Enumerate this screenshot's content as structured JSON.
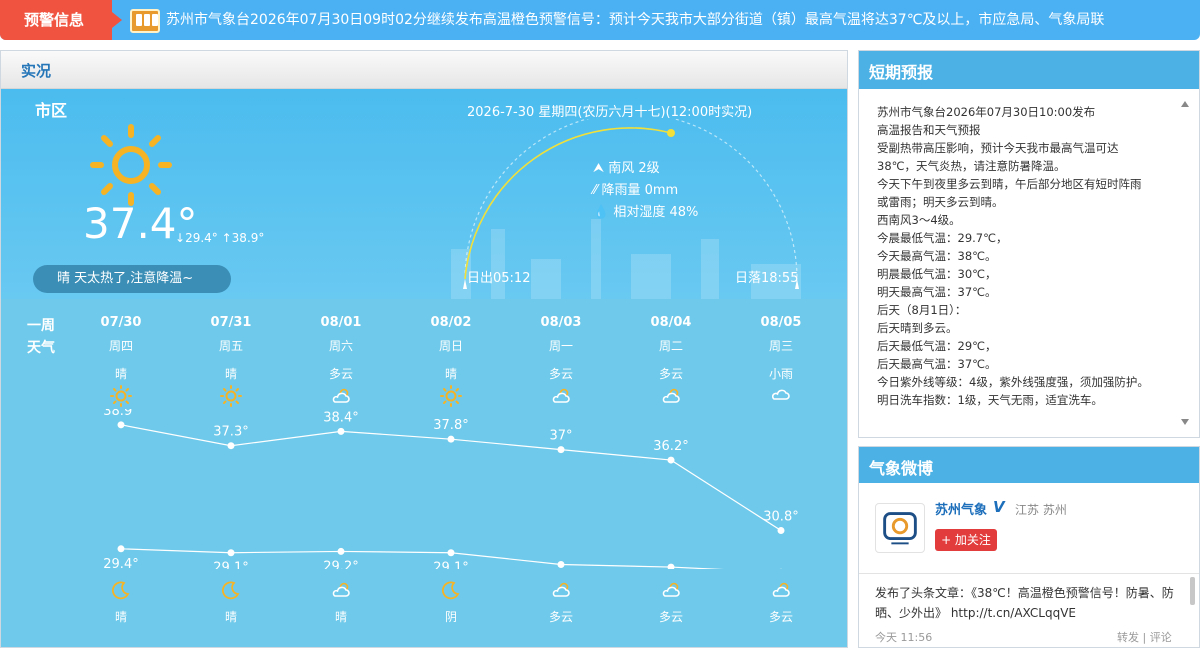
{
  "alert": {
    "tag": "预警信息",
    "text": "苏州市气象台2026年07月30日09时02分继续发布高温橙色预警信号：预计今天我市大部分街道（镇）最高气温将达37℃及以上，市应急局、气象局联"
  },
  "now": {
    "panel_title": "实况",
    "city": "市区",
    "temperature": "37.4°",
    "low": "29.4°",
    "high": "38.9°",
    "description": "晴  天太热了,注意降温~",
    "date_line": "2026-7-30  星期四(农历六月十七)(12:00时实况)",
    "wind": "南风  2级",
    "rain": "降雨量  0mm",
    "humidity": "相对湿度  48%",
    "sunrise": "日出05:12",
    "sunset": "日落18:55"
  },
  "week": {
    "label_line1": "一周",
    "label_line2": "天气",
    "days": [
      {
        "date": "07/30",
        "weekday": "周四",
        "day_cond": "晴",
        "day_icon": "sunny-icon",
        "high": "38.9°",
        "low": "29.4°",
        "night_icon": "moon-icon",
        "night_cond": "晴"
      },
      {
        "date": "07/31",
        "weekday": "周五",
        "day_cond": "晴",
        "day_icon": "sunny-icon",
        "high": "37.3°",
        "low": "29.1°",
        "night_icon": "moon-icon",
        "night_cond": "晴"
      },
      {
        "date": "08/01",
        "weekday": "周六",
        "day_cond": "多云",
        "day_icon": "cloudy-icon",
        "high": "38.4°",
        "low": "29.2°",
        "night_icon": "cloudy-icon",
        "night_cond": "晴"
      },
      {
        "date": "08/02",
        "weekday": "周日",
        "day_cond": "晴",
        "day_icon": "sunny-icon",
        "high": "37.8°",
        "low": "29.1°",
        "night_icon": "moon-icon",
        "night_cond": "阴"
      },
      {
        "date": "08/03",
        "weekday": "周一",
        "day_cond": "多云",
        "day_icon": "cloudy-icon",
        "high": "37°",
        "low": "28.2°",
        "night_icon": "cloudy-icon",
        "night_cond": "多云"
      },
      {
        "date": "08/04",
        "weekday": "周二",
        "day_cond": "多云",
        "day_icon": "cloudy-icon",
        "high": "36.2°",
        "low": "28°",
        "night_icon": "cloudy-icon",
        "night_cond": "多云"
      },
      {
        "date": "08/05",
        "weekday": "周三",
        "day_cond": "小雨",
        "day_icon": "rain-cloud-icon",
        "high": "30.8°",
        "low": "27.6°",
        "night_icon": "cloudy-icon",
        "night_cond": "多云"
      }
    ]
  },
  "chart_data": {
    "type": "line",
    "categories": [
      "07/30",
      "07/31",
      "08/01",
      "08/02",
      "08/03",
      "08/04",
      "08/05"
    ],
    "series": [
      {
        "values": [
          38.9,
          37.3,
          38.4,
          37.8,
          37,
          36.2,
          30.8
        ]
      },
      {
        "values": [
          29.4,
          29.1,
          29.2,
          29.1,
          28.2,
          28,
          27.6
        ]
      }
    ]
  },
  "short_forecast": {
    "title": "短期预报",
    "lines": [
      "苏州市气象台2026年07月30日10:00发布",
      "高温报告和天气预报",
      "受副热带高压影响，预计今天我市最高气温可达",
      "38℃，天气炎热，请注意防暑降温。",
      "今天下午到夜里多云到晴，午后部分地区有短时阵雨",
      "或雷雨；明天多云到晴。",
      "西南风3～4级。",
      "今晨最低气温：29.7℃，",
      "今天最高气温：38℃。",
      "明晨最低气温：30℃，",
      "明天最高气温：37℃。",
      "后天（8月1日）：",
      "后天晴到多云。",
      "后天最低气温：29℃，",
      "后天最高气温：37℃。",
      "今日紫外线等级：4级，紫外线强度强，须加强防护。",
      "明日洗车指数：1级，天气无雨，适宜洗车。"
    ]
  },
  "weibo": {
    "title": "气象微博",
    "name": "苏州气象",
    "verified": "V",
    "location": "江苏 苏州",
    "follow": "+ 加关注",
    "post": "发布了头条文章：《38℃！高温橙色预警信号！防暑、防晒、少外出》 http://t.cn/AXCLqqVE",
    "time": "今天 11:56",
    "repost": "转发",
    "sep": "|",
    "comment": "评论"
  },
  "colors": {
    "alert_red": "#f0533f",
    "accent_blue": "#4cb1e4",
    "sun_yellow": "#f6b425"
  }
}
